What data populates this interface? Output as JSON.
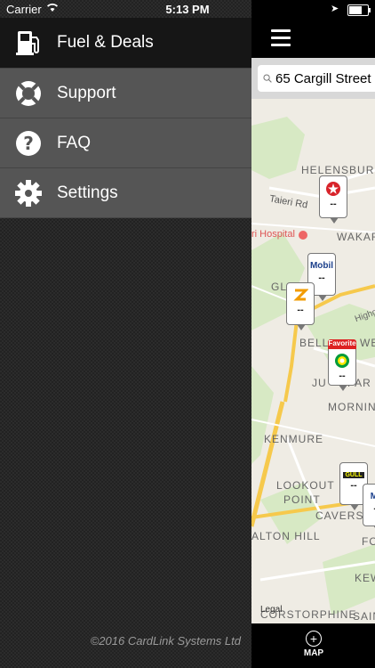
{
  "status": {
    "carrier": "Carrier",
    "time": "5:13 PM"
  },
  "menu": {
    "items": [
      {
        "label": "Fuel & Deals",
        "icon": "fuel-pump-icon",
        "active": true
      },
      {
        "label": "Support",
        "icon": "lifebuoy-icon",
        "active": false
      },
      {
        "label": "FAQ",
        "icon": "question-icon",
        "active": false
      },
      {
        "label": "Settings",
        "icon": "gear-icon",
        "active": false
      }
    ],
    "copyright": "©2016 CardLink Systems Ltd"
  },
  "map": {
    "search_value": "65 Cargill Street",
    "labels": [
      "HELENSBURG",
      "Taieri Rd",
      "ri Hospital",
      "WAKAR",
      "GL",
      "BELL",
      "WE",
      "JU",
      "PAR",
      "MORNINGTO",
      "KENMURE",
      "LOOKOUT",
      "POINT",
      "CAVERS",
      "ALTON HILL",
      "FO",
      "KEW",
      "CORSTORPHINE",
      "SAIN",
      "Highg"
    ],
    "pins": [
      {
        "brand": "CALTEX",
        "price": "--",
        "favorite": false
      },
      {
        "brand": "Mobil",
        "price": "--",
        "favorite": false
      },
      {
        "brand": "Z ENERGY",
        "price": "--",
        "favorite": false
      },
      {
        "brand": "bp",
        "price": "--",
        "favorite": true,
        "favorite_label": "Favorite"
      },
      {
        "brand": "GULL",
        "price": "--",
        "favorite": false
      },
      {
        "brand": "Mo",
        "price": "--",
        "favorite": false
      }
    ],
    "legal": "Legal",
    "map_button_label": "MAP"
  },
  "colors": {
    "drawer_active": "#161616",
    "drawer_item": "#555555",
    "caltex_red": "#d8232a",
    "mobil_blue": "#1b3f8b",
    "z_orange": "#f29b00",
    "bp_green": "#009b3a"
  }
}
